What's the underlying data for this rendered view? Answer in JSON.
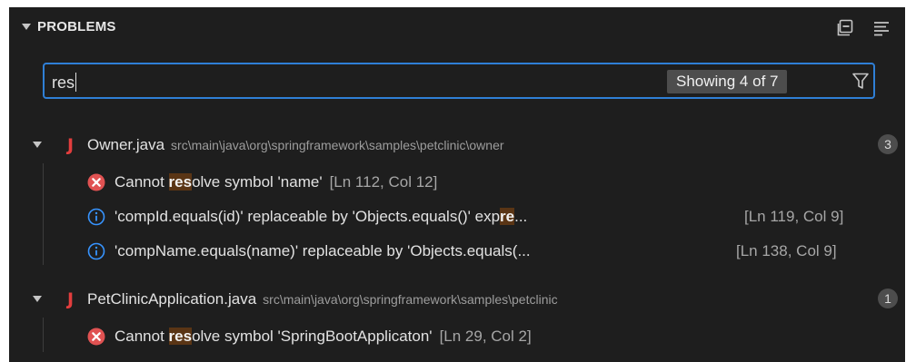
{
  "header": {
    "title": "PROBLEMS"
  },
  "filter": {
    "value": "res",
    "count_badge": "Showing 4 of 7"
  },
  "files": [
    {
      "name": "Owner.java",
      "path": "src\\main\\java\\org\\springframework\\samples\\petclinic\\owner",
      "count": "3",
      "problems": [
        {
          "severity": "error",
          "pre": "Cannot ",
          "match": "res",
          "post": "olve symbol 'name'",
          "location": "[Ln 112, Col 12]"
        },
        {
          "severity": "info",
          "pre": "'compId.equals(id)' replaceable by 'Objects.equals()' exp",
          "match": "re",
          "post": "...",
          "location": "[Ln 119, Col 9]"
        },
        {
          "severity": "info",
          "pre": "'compName.equals(name)' replaceable by 'Objects.equals(...",
          "match": "",
          "post": "",
          "location": "[Ln 138, Col 9]"
        }
      ]
    },
    {
      "name": "PetClinicApplication.java",
      "path": "src\\main\\java\\org\\springframework\\samples\\petclinic",
      "count": "1",
      "problems": [
        {
          "severity": "error",
          "pre": "Cannot ",
          "match": "res",
          "post": "olve symbol 'SpringBootApplicaton'",
          "location": "[Ln 29, Col 2]"
        }
      ]
    }
  ],
  "colors": {
    "panel_bg": "#1e1e1e",
    "focus_border": "#2f7fd6",
    "error": "#e05252",
    "info": "#3794ff",
    "java": "#e23d3d",
    "match_highlight": "#5a3515"
  },
  "icons": {
    "collapse": "chevron-down-icon",
    "collapse_all": "collapse-all-icon",
    "view_as_list": "list-view-icon",
    "filter": "filter-icon",
    "java": "java-file-icon",
    "error": "error-icon",
    "info": "info-icon"
  }
}
